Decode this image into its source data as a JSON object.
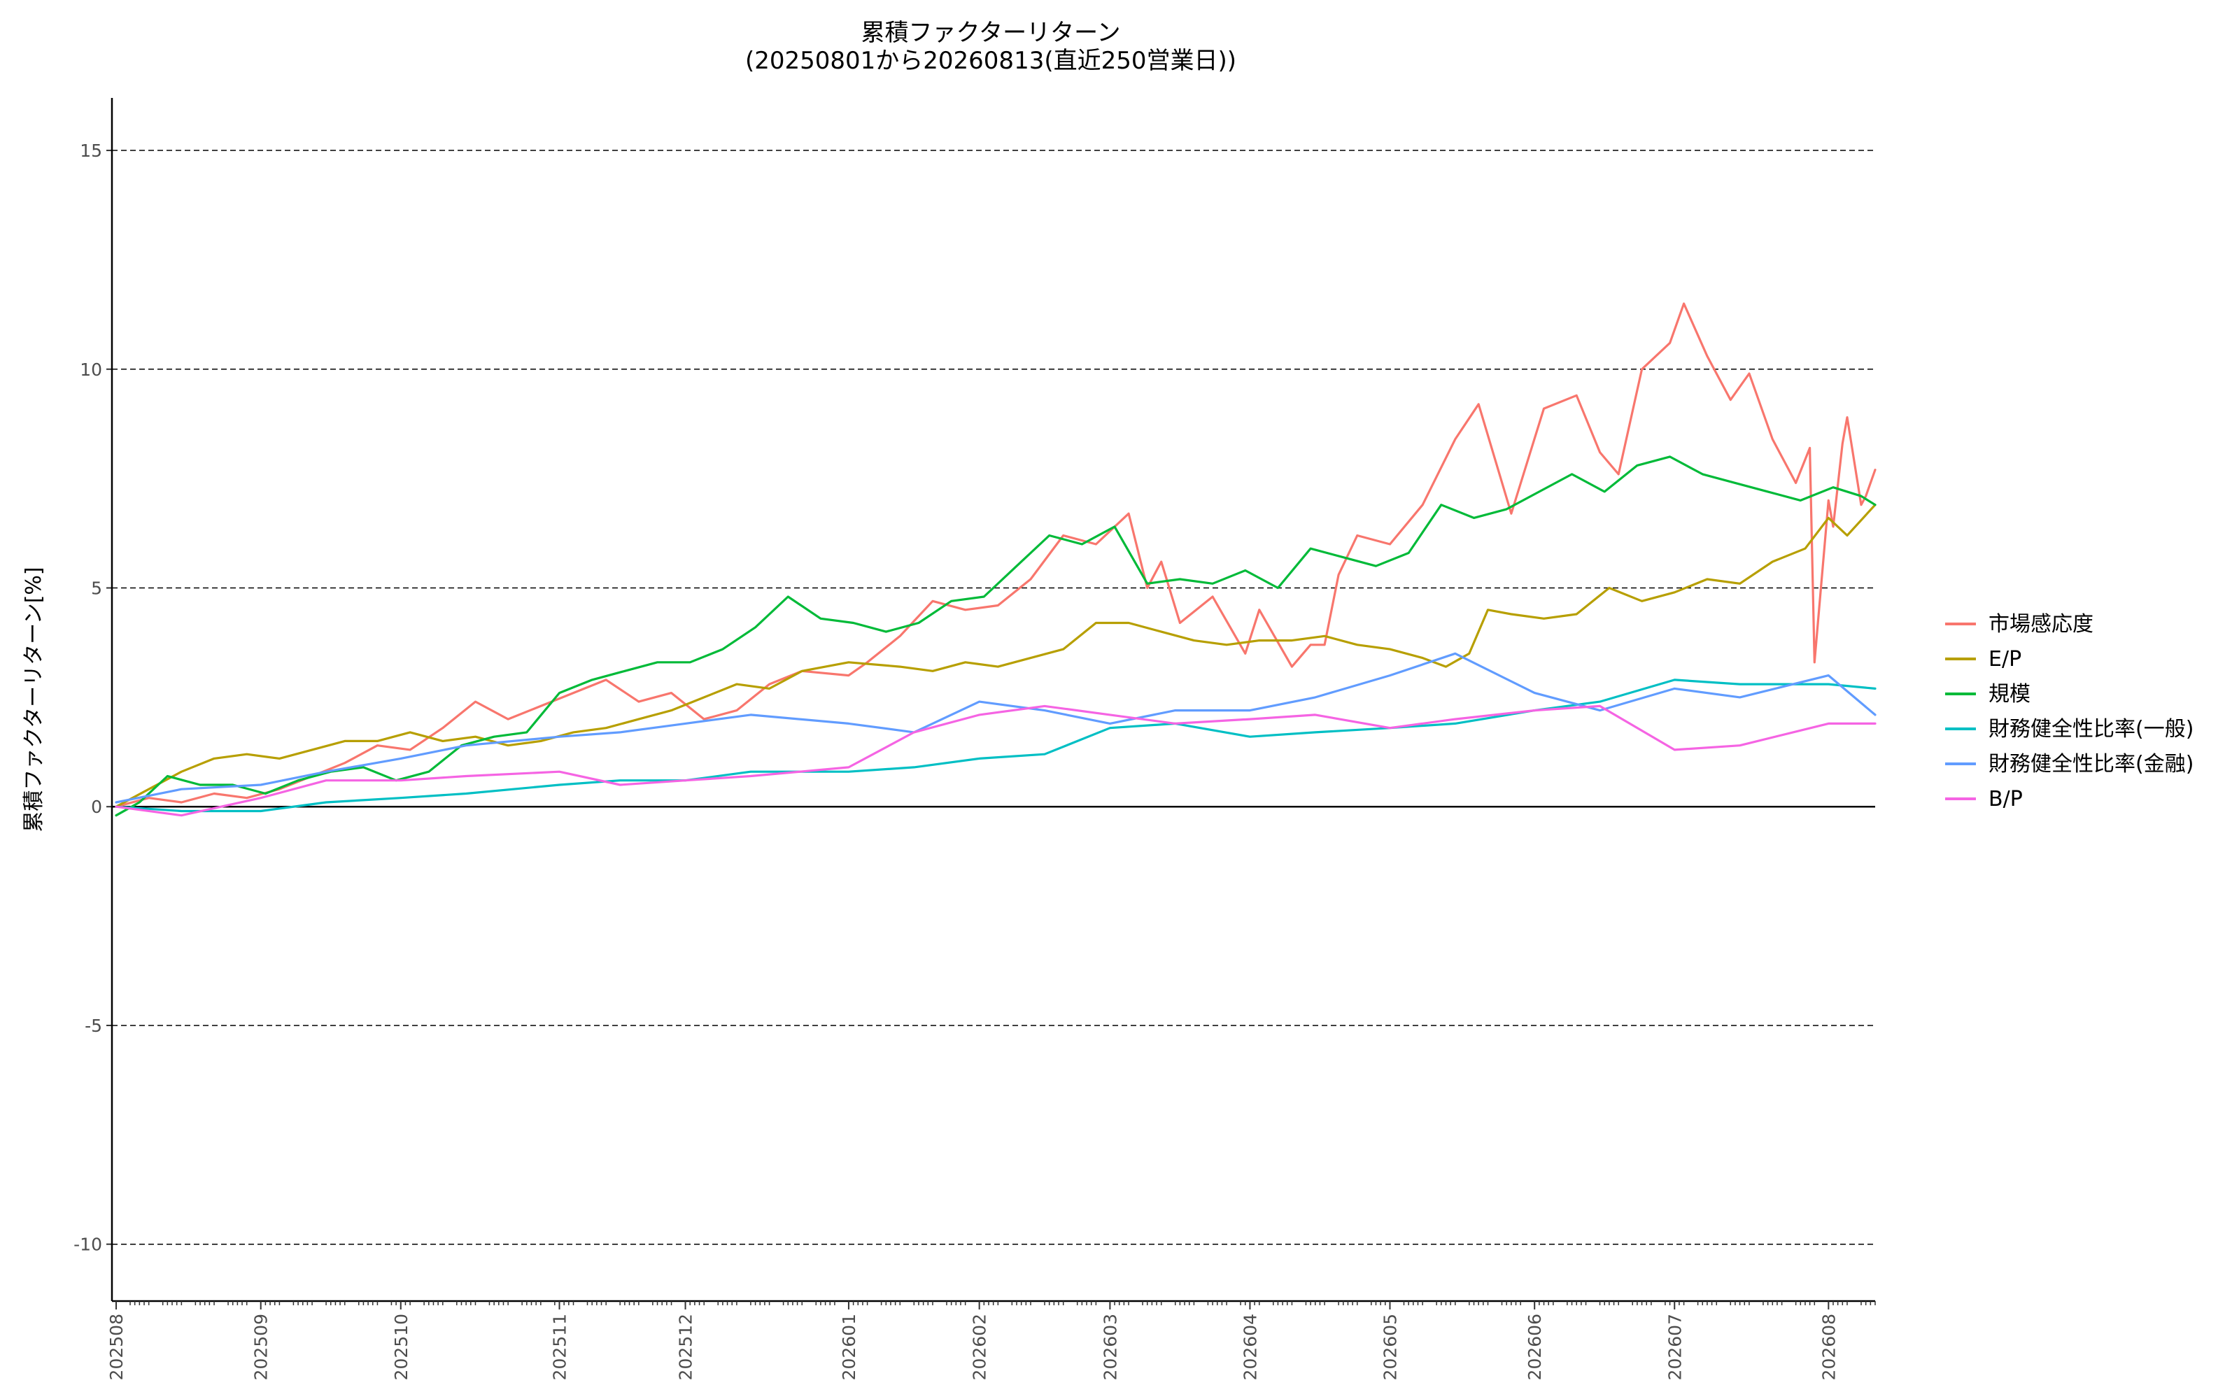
{
  "chart_data": {
    "type": "line",
    "title": "累積ファクターリターン",
    "subtitle": "(20250801から20260813(直近250営業日))",
    "ylabel": "累積ファクターリターン[%]",
    "xlabel": "",
    "ylim": [
      -11.3,
      16.2
    ],
    "yticks": [
      -10,
      -5,
      0,
      5,
      10,
      15
    ],
    "grid": "horizontal dashed at y ticks",
    "legend_position": "right",
    "x_range": [
      "2025-08-01",
      "2026-08-13"
    ],
    "x_tick_labels": [
      {
        "label": "202508",
        "date": "2025-08-01"
      },
      {
        "label": "202509",
        "date": "2025-09-01"
      },
      {
        "label": "202510",
        "date": "2025-10-01"
      },
      {
        "label": "202511",
        "date": "2025-11-04"
      },
      {
        "label": "202512",
        "date": "2025-12-01"
      },
      {
        "label": "202601",
        "date": "2026-01-05"
      },
      {
        "label": "202602",
        "date": "2026-02-02"
      },
      {
        "label": "202603",
        "date": "2026-03-02"
      },
      {
        "label": "202604",
        "date": "2026-04-01"
      },
      {
        "label": "202605",
        "date": "2026-05-01"
      },
      {
        "label": "202606",
        "date": "2026-06-01"
      },
      {
        "label": "202607",
        "date": "2026-07-01"
      },
      {
        "label": "202608",
        "date": "2026-08-03"
      }
    ],
    "series": [
      {
        "name": "市場感応度",
        "color": "#F8766D",
        "points": [
          [
            "2025-08-01",
            0.0
          ],
          [
            "2025-08-08",
            0.2
          ],
          [
            "2025-08-15",
            0.1
          ],
          [
            "2025-08-22",
            0.3
          ],
          [
            "2025-08-29",
            0.2
          ],
          [
            "2025-09-05",
            0.4
          ],
          [
            "2025-09-12",
            0.7
          ],
          [
            "2025-09-19",
            1.0
          ],
          [
            "2025-09-26",
            1.4
          ],
          [
            "2025-10-03",
            1.3
          ],
          [
            "2025-10-10",
            1.8
          ],
          [
            "2025-10-17",
            2.4
          ],
          [
            "2025-10-24",
            2.0
          ],
          [
            "2025-10-31",
            2.3
          ],
          [
            "2025-11-07",
            2.6
          ],
          [
            "2025-11-14",
            2.9
          ],
          [
            "2025-11-21",
            2.4
          ],
          [
            "2025-11-28",
            2.6
          ],
          [
            "2025-12-05",
            2.0
          ],
          [
            "2025-12-12",
            2.2
          ],
          [
            "2025-12-19",
            2.8
          ],
          [
            "2025-12-26",
            3.1
          ],
          [
            "2026-01-05",
            3.0
          ],
          [
            "2026-01-09",
            3.3
          ],
          [
            "2026-01-16",
            3.9
          ],
          [
            "2026-01-23",
            4.7
          ],
          [
            "2026-01-30",
            4.5
          ],
          [
            "2026-02-06",
            4.6
          ],
          [
            "2026-02-13",
            5.2
          ],
          [
            "2026-02-20",
            6.2
          ],
          [
            "2026-02-27",
            6.0
          ],
          [
            "2026-03-06",
            6.7
          ],
          [
            "2026-03-10",
            5.0
          ],
          [
            "2026-03-13",
            5.6
          ],
          [
            "2026-03-17",
            4.2
          ],
          [
            "2026-03-24",
            4.8
          ],
          [
            "2026-03-31",
            3.5
          ],
          [
            "2026-04-03",
            4.5
          ],
          [
            "2026-04-10",
            3.2
          ],
          [
            "2026-04-14",
            3.7
          ],
          [
            "2026-04-17",
            3.7
          ],
          [
            "2026-04-20",
            5.3
          ],
          [
            "2026-04-24",
            6.2
          ],
          [
            "2026-05-01",
            6.0
          ],
          [
            "2026-05-08",
            6.9
          ],
          [
            "2026-05-15",
            8.4
          ],
          [
            "2026-05-20",
            9.2
          ],
          [
            "2026-05-27",
            6.7
          ],
          [
            "2026-06-03",
            9.1
          ],
          [
            "2026-06-10",
            9.4
          ],
          [
            "2026-06-15",
            8.1
          ],
          [
            "2026-06-19",
            7.6
          ],
          [
            "2026-06-24",
            10.0
          ],
          [
            "2026-06-30",
            10.6
          ],
          [
            "2026-07-03",
            11.5
          ],
          [
            "2026-07-08",
            10.3
          ],
          [
            "2026-07-13",
            9.3
          ],
          [
            "2026-07-17",
            9.9
          ],
          [
            "2026-07-22",
            8.4
          ],
          [
            "2026-07-27",
            7.4
          ],
          [
            "2026-07-30",
            8.2
          ],
          [
            "2026-08-03",
            7.0
          ],
          [
            "2026-08-06",
            8.3
          ],
          [
            "2026-08-10",
            6.9
          ],
          [
            "2026-07-31",
            3.3
          ],
          [
            "2026-08-04",
            6.4
          ],
          [
            "2026-08-07",
            8.9
          ],
          [
            "2026-08-11",
            7.1
          ],
          [
            "2026-08-13",
            7.7
          ]
        ]
      },
      {
        "name": "E/P",
        "color": "#B79F00",
        "points": [
          [
            "2025-08-01",
            0.0
          ],
          [
            "2025-08-08",
            0.4
          ],
          [
            "2025-08-15",
            0.8
          ],
          [
            "2025-08-22",
            1.1
          ],
          [
            "2025-08-29",
            1.2
          ],
          [
            "2025-09-05",
            1.1
          ],
          [
            "2025-09-12",
            1.3
          ],
          [
            "2025-09-19",
            1.5
          ],
          [
            "2025-09-26",
            1.5
          ],
          [
            "2025-10-03",
            1.7
          ],
          [
            "2025-10-10",
            1.5
          ],
          [
            "2025-10-17",
            1.6
          ],
          [
            "2025-10-24",
            1.4
          ],
          [
            "2025-10-31",
            1.5
          ],
          [
            "2025-11-07",
            1.7
          ],
          [
            "2025-11-14",
            1.8
          ],
          [
            "2025-11-21",
            2.0
          ],
          [
            "2025-11-28",
            2.2
          ],
          [
            "2025-12-05",
            2.5
          ],
          [
            "2025-12-12",
            2.8
          ],
          [
            "2025-12-19",
            2.7
          ],
          [
            "2025-12-26",
            3.1
          ],
          [
            "2026-01-05",
            3.3
          ],
          [
            "2026-01-16",
            3.2
          ],
          [
            "2026-01-23",
            3.1
          ],
          [
            "2026-01-30",
            3.3
          ],
          [
            "2026-02-06",
            3.2
          ],
          [
            "2026-02-13",
            3.4
          ],
          [
            "2026-02-20",
            3.6
          ],
          [
            "2026-02-27",
            4.2
          ],
          [
            "2026-03-06",
            4.2
          ],
          [
            "2026-03-13",
            4.0
          ],
          [
            "2026-03-20",
            3.8
          ],
          [
            "2026-03-27",
            3.7
          ],
          [
            "2026-04-03",
            3.8
          ],
          [
            "2026-04-10",
            3.8
          ],
          [
            "2026-04-17",
            3.9
          ],
          [
            "2026-04-24",
            3.7
          ],
          [
            "2026-05-01",
            3.6
          ],
          [
            "2026-05-08",
            3.4
          ],
          [
            "2026-05-13",
            3.2
          ],
          [
            "2026-05-18",
            3.5
          ],
          [
            "2026-05-22",
            4.5
          ],
          [
            "2026-05-27",
            4.4
          ],
          [
            "2026-06-03",
            4.3
          ],
          [
            "2026-06-10",
            4.4
          ],
          [
            "2026-06-17",
            5.0
          ],
          [
            "2026-06-24",
            4.7
          ],
          [
            "2026-07-01",
            4.9
          ],
          [
            "2026-07-08",
            5.2
          ],
          [
            "2026-07-15",
            5.1
          ],
          [
            "2026-07-22",
            5.6
          ],
          [
            "2026-07-29",
            5.9
          ],
          [
            "2026-08-03",
            6.6
          ],
          [
            "2026-08-07",
            6.2
          ],
          [
            "2026-08-13",
            6.9
          ]
        ]
      },
      {
        "name": "規模",
        "color": "#00BA38",
        "points": [
          [
            "2025-08-01",
            -0.2
          ],
          [
            "2025-08-06",
            0.1
          ],
          [
            "2025-08-12",
            0.7
          ],
          [
            "2025-08-19",
            0.5
          ],
          [
            "2025-08-26",
            0.5
          ],
          [
            "2025-09-02",
            0.3
          ],
          [
            "2025-09-09",
            0.6
          ],
          [
            "2025-09-16",
            0.8
          ],
          [
            "2025-09-23",
            0.9
          ],
          [
            "2025-09-30",
            0.6
          ],
          [
            "2025-10-07",
            0.8
          ],
          [
            "2025-10-14",
            1.4
          ],
          [
            "2025-10-21",
            1.6
          ],
          [
            "2025-10-28",
            1.7
          ],
          [
            "2025-11-04",
            2.6
          ],
          [
            "2025-11-11",
            2.9
          ],
          [
            "2025-11-18",
            3.1
          ],
          [
            "2025-11-25",
            3.3
          ],
          [
            "2025-12-02",
            3.3
          ],
          [
            "2025-12-09",
            3.6
          ],
          [
            "2025-12-16",
            4.1
          ],
          [
            "2025-12-23",
            4.8
          ],
          [
            "2025-12-30",
            4.3
          ],
          [
            "2026-01-06",
            4.2
          ],
          [
            "2026-01-13",
            4.0
          ],
          [
            "2026-01-20",
            4.2
          ],
          [
            "2026-01-27",
            4.7
          ],
          [
            "2026-02-03",
            4.8
          ],
          [
            "2026-02-10",
            5.5
          ],
          [
            "2026-02-17",
            6.2
          ],
          [
            "2026-02-24",
            6.0
          ],
          [
            "2026-03-03",
            6.4
          ],
          [
            "2026-03-10",
            5.1
          ],
          [
            "2026-03-17",
            5.2
          ],
          [
            "2026-03-24",
            5.1
          ],
          [
            "2026-03-31",
            5.4
          ],
          [
            "2026-04-07",
            5.0
          ],
          [
            "2026-04-14",
            5.9
          ],
          [
            "2026-04-21",
            5.7
          ],
          [
            "2026-04-28",
            5.5
          ],
          [
            "2026-05-05",
            5.8
          ],
          [
            "2026-05-12",
            6.9
          ],
          [
            "2026-05-19",
            6.6
          ],
          [
            "2026-05-26",
            6.8
          ],
          [
            "2026-06-02",
            7.2
          ],
          [
            "2026-06-09",
            7.6
          ],
          [
            "2026-06-16",
            7.2
          ],
          [
            "2026-06-23",
            7.8
          ],
          [
            "2026-06-30",
            8.0
          ],
          [
            "2026-07-07",
            7.6
          ],
          [
            "2026-07-14",
            7.4
          ],
          [
            "2026-07-21",
            7.2
          ],
          [
            "2026-07-28",
            7.0
          ],
          [
            "2026-08-04",
            7.3
          ],
          [
            "2026-08-10",
            7.1
          ],
          [
            "2026-08-13",
            6.9
          ]
        ]
      },
      {
        "name": "財務健全性比率(一般)",
        "color": "#00BFC4",
        "points": [
          [
            "2025-08-01",
            0.0
          ],
          [
            "2025-08-15",
            -0.1
          ],
          [
            "2025-09-01",
            -0.1
          ],
          [
            "2025-09-15",
            0.1
          ],
          [
            "2025-10-01",
            0.2
          ],
          [
            "2025-10-15",
            0.3
          ],
          [
            "2025-11-04",
            0.5
          ],
          [
            "2025-11-17",
            0.6
          ],
          [
            "2025-12-01",
            0.6
          ],
          [
            "2025-12-15",
            0.8
          ],
          [
            "2026-01-05",
            0.8
          ],
          [
            "2026-01-19",
            0.9
          ],
          [
            "2026-02-02",
            1.1
          ],
          [
            "2026-02-16",
            1.2
          ],
          [
            "2026-03-02",
            1.8
          ],
          [
            "2026-03-16",
            1.9
          ],
          [
            "2026-04-01",
            1.6
          ],
          [
            "2026-04-15",
            1.7
          ],
          [
            "2026-05-01",
            1.8
          ],
          [
            "2026-05-15",
            1.9
          ],
          [
            "2026-06-01",
            2.2
          ],
          [
            "2026-06-15",
            2.4
          ],
          [
            "2026-07-01",
            2.9
          ],
          [
            "2026-07-15",
            2.8
          ],
          [
            "2026-08-03",
            2.8
          ],
          [
            "2026-08-13",
            2.7
          ]
        ]
      },
      {
        "name": "財務健全性比率(金融)",
        "color": "#619CFF",
        "points": [
          [
            "2025-08-01",
            0.1
          ],
          [
            "2025-08-15",
            0.4
          ],
          [
            "2025-09-01",
            0.5
          ],
          [
            "2025-09-15",
            0.8
          ],
          [
            "2025-10-01",
            1.1
          ],
          [
            "2025-10-15",
            1.4
          ],
          [
            "2025-11-04",
            1.6
          ],
          [
            "2025-11-17",
            1.7
          ],
          [
            "2025-12-01",
            1.9
          ],
          [
            "2025-12-15",
            2.1
          ],
          [
            "2026-01-05",
            1.9
          ],
          [
            "2026-01-19",
            1.7
          ],
          [
            "2026-02-02",
            2.4
          ],
          [
            "2026-02-16",
            2.2
          ],
          [
            "2026-03-02",
            1.9
          ],
          [
            "2026-03-16",
            2.2
          ],
          [
            "2026-04-01",
            2.2
          ],
          [
            "2026-04-15",
            2.5
          ],
          [
            "2026-05-01",
            3.0
          ],
          [
            "2026-05-15",
            3.5
          ],
          [
            "2026-06-01",
            2.6
          ],
          [
            "2026-06-15",
            2.2
          ],
          [
            "2026-07-01",
            2.7
          ],
          [
            "2026-07-15",
            2.5
          ],
          [
            "2026-08-03",
            3.0
          ],
          [
            "2026-08-13",
            2.1
          ]
        ]
      },
      {
        "name": "B/P",
        "color": "#F564E3",
        "points": [
          [
            "2025-08-01",
            0.0
          ],
          [
            "2025-08-15",
            -0.2
          ],
          [
            "2025-09-01",
            0.2
          ],
          [
            "2025-09-15",
            0.6
          ],
          [
            "2025-10-01",
            0.6
          ],
          [
            "2025-10-15",
            0.7
          ],
          [
            "2025-11-04",
            0.8
          ],
          [
            "2025-11-17",
            0.5
          ],
          [
            "2025-12-01",
            0.6
          ],
          [
            "2025-12-15",
            0.7
          ],
          [
            "2026-01-05",
            0.9
          ],
          [
            "2026-01-19",
            1.7
          ],
          [
            "2026-02-02",
            2.1
          ],
          [
            "2026-02-16",
            2.3
          ],
          [
            "2026-03-02",
            2.1
          ],
          [
            "2026-03-16",
            1.9
          ],
          [
            "2026-04-01",
            2.0
          ],
          [
            "2026-04-15",
            2.1
          ],
          [
            "2026-05-01",
            1.8
          ],
          [
            "2026-05-15",
            2.0
          ],
          [
            "2026-06-01",
            2.2
          ],
          [
            "2026-06-15",
            2.3
          ],
          [
            "2026-07-01",
            1.3
          ],
          [
            "2026-07-15",
            1.4
          ],
          [
            "2026-08-03",
            1.9
          ],
          [
            "2026-08-13",
            1.9
          ]
        ]
      }
    ]
  }
}
